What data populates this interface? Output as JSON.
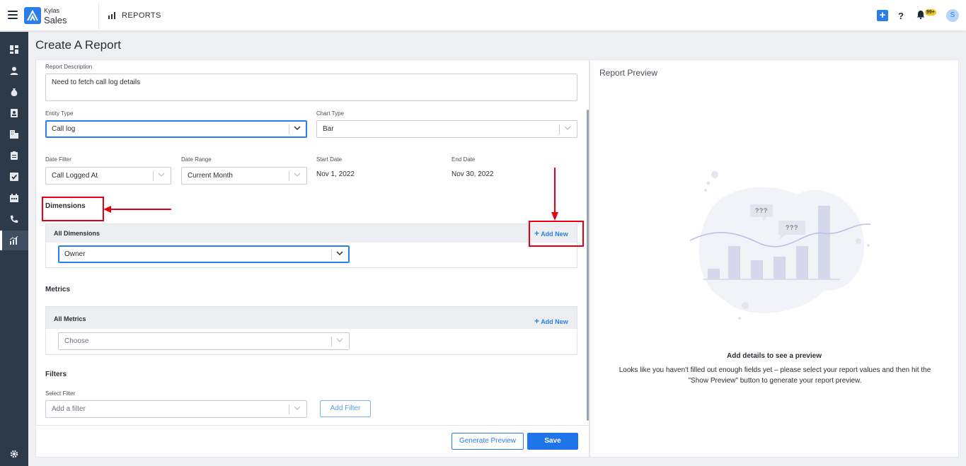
{
  "app": {
    "brand_top": "Kylas",
    "brand_main": "Sales",
    "section": "REPORTS",
    "notification_count": "99+",
    "avatar_initial": "S",
    "accent_color": "#2b7de9"
  },
  "sidebar": {
    "items": [
      "dashboard-icon",
      "user-icon",
      "money-bag-icon",
      "contact-card-icon",
      "company-icon",
      "clipboard-icon",
      "task-check-icon",
      "calendar-icon",
      "phone-icon",
      "reports-icon"
    ],
    "bottom": "settings-icon"
  },
  "page": {
    "title": "Create A Report"
  },
  "form": {
    "description_label": "Report Description",
    "description_value": "Need to fetch call log details",
    "entity_type_label": "Entity Type",
    "entity_type_value": "Call log",
    "chart_type_label": "Chart Type",
    "chart_type_value": "Bar",
    "date_filter_label": "Date Filter",
    "date_filter_value": "Call Logged At",
    "date_range_label": "Date Range",
    "date_range_value": "Current Month",
    "start_date_label": "Start Date",
    "start_date_value": "Nov 1, 2022",
    "end_date_label": "End Date",
    "end_date_value": "Nov 30, 2022"
  },
  "dimensions": {
    "title": "Dimensions",
    "header": "All Dimensions",
    "add_new": "Add New",
    "value": "Owner"
  },
  "metrics": {
    "title": "Metrics",
    "header": "All Metrics",
    "add_new": "Add New",
    "placeholder": "Choose"
  },
  "filters": {
    "title": "Filters",
    "select_label": "Select Filter",
    "placeholder": "Add a filter",
    "add_button": "Add Filter"
  },
  "actions": {
    "preview_button": "Generate Preview",
    "save_button": "Save"
  },
  "preview": {
    "title": "Report Preview",
    "question_marks": "???",
    "heading": "Add details to see a preview",
    "text": "Looks like you haven't filled out enough fields yet – please select your report values and then hit the \"Show Preview\" button to generate your report preview."
  }
}
